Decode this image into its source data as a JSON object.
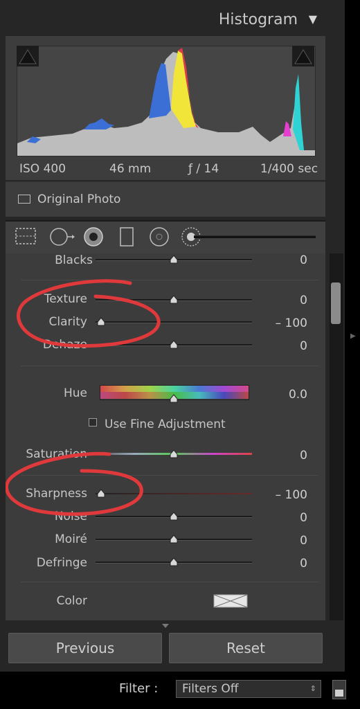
{
  "histogram": {
    "title": "Histogram",
    "info": {
      "iso": "ISO 400",
      "focal": "46 mm",
      "aperture": "ƒ / 14",
      "shutter": "1/400 sec"
    },
    "original_photo_label": "Original Photo"
  },
  "detail": {
    "blacks": {
      "label": "Blacks",
      "value": "0",
      "level": 0.5
    },
    "texture": {
      "label": "Texture",
      "value": "0",
      "level": 0.5
    },
    "clarity": {
      "label": "Clarity",
      "value": "– 100",
      "level": 0.0
    },
    "dehaze": {
      "label": "Dehaze",
      "value": "0",
      "level": 0.5
    },
    "hue": {
      "label": "Hue",
      "value": "0.0",
      "level": 0.5
    },
    "fine_adjust_label": "Use Fine Adjustment",
    "saturation": {
      "label": "Saturation",
      "value": "0",
      "level": 0.5
    },
    "sharpness": {
      "label": "Sharpness",
      "value": "– 100",
      "level": 0.0
    },
    "noise": {
      "label": "Noise",
      "value": "0",
      "level": 0.5
    },
    "moire": {
      "label": "Moiré",
      "value": "0",
      "level": 0.5
    },
    "defringe": {
      "label": "Defringe",
      "value": "0",
      "level": 0.5
    },
    "color_label": "Color"
  },
  "buttons": {
    "previous": "Previous",
    "reset": "Reset"
  },
  "filter": {
    "label": "Filter :",
    "value": "Filters Off"
  },
  "colors": {
    "annotation": "#e0393b",
    "panel": "#3c3c3c"
  }
}
